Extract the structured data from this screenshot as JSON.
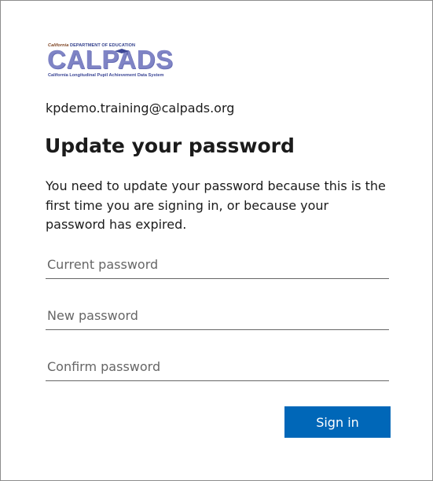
{
  "logo": {
    "top_text_state": "California",
    "top_text_dept": "DEPARTMENT OF EDUCATION",
    "wordmark": "CALPADS",
    "subtitle": "California Longitudinal Pupil Achievement Data System",
    "icon": "graduation-cap-icon"
  },
  "account": {
    "email": "kpdemo.training@calpads.org"
  },
  "form": {
    "title": "Update your password",
    "description": "You need to update your password because this is the first time you are signing in, or because your password has expired.",
    "current_password_placeholder": "Current password",
    "new_password_placeholder": "New password",
    "confirm_password_placeholder": "Confirm password",
    "submit_label": "Sign in"
  },
  "colors": {
    "primary_button": "#0067b8",
    "logo_wordmark": "#7f84c5",
    "field_underline": "#666666"
  }
}
